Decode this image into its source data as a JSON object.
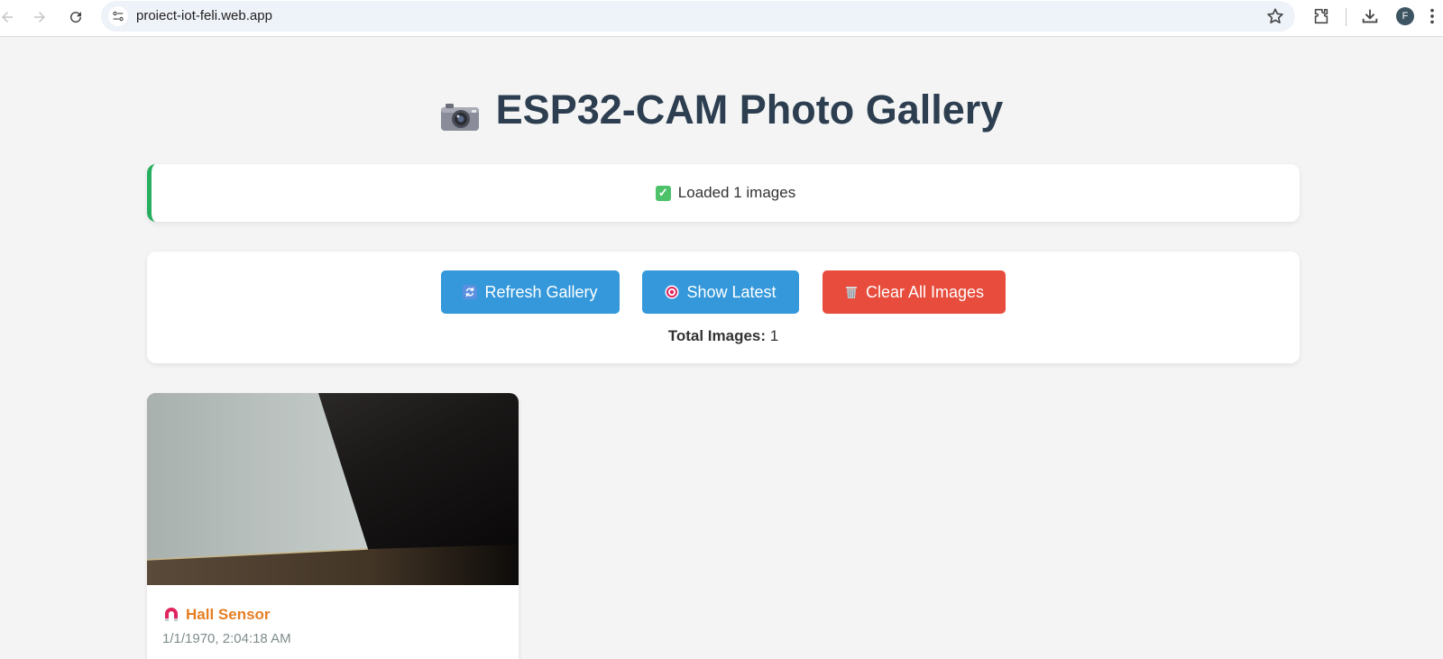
{
  "browser": {
    "url": "proiect-iot-feli.web.app",
    "profile_initial": "F"
  },
  "page": {
    "title": "ESP32-CAM Photo Gallery",
    "title_icon": "camera-icon"
  },
  "status": {
    "icon": "check-icon",
    "text": "Loaded 1 images",
    "accent_color": "#27ae60"
  },
  "controls": {
    "refresh_label": "Refresh Gallery",
    "latest_label": "Show Latest",
    "clear_label": "Clear All Images",
    "total_label": "Total Images:",
    "total_value": "1",
    "primary_color": "#3498db",
    "danger_color": "#e74c3c"
  },
  "gallery": {
    "items": [
      {
        "sensor_icon": "magnet-icon",
        "sensor_label": "Hall Sensor",
        "timestamp": "1/1/1970, 2:04:18 AM"
      }
    ]
  }
}
